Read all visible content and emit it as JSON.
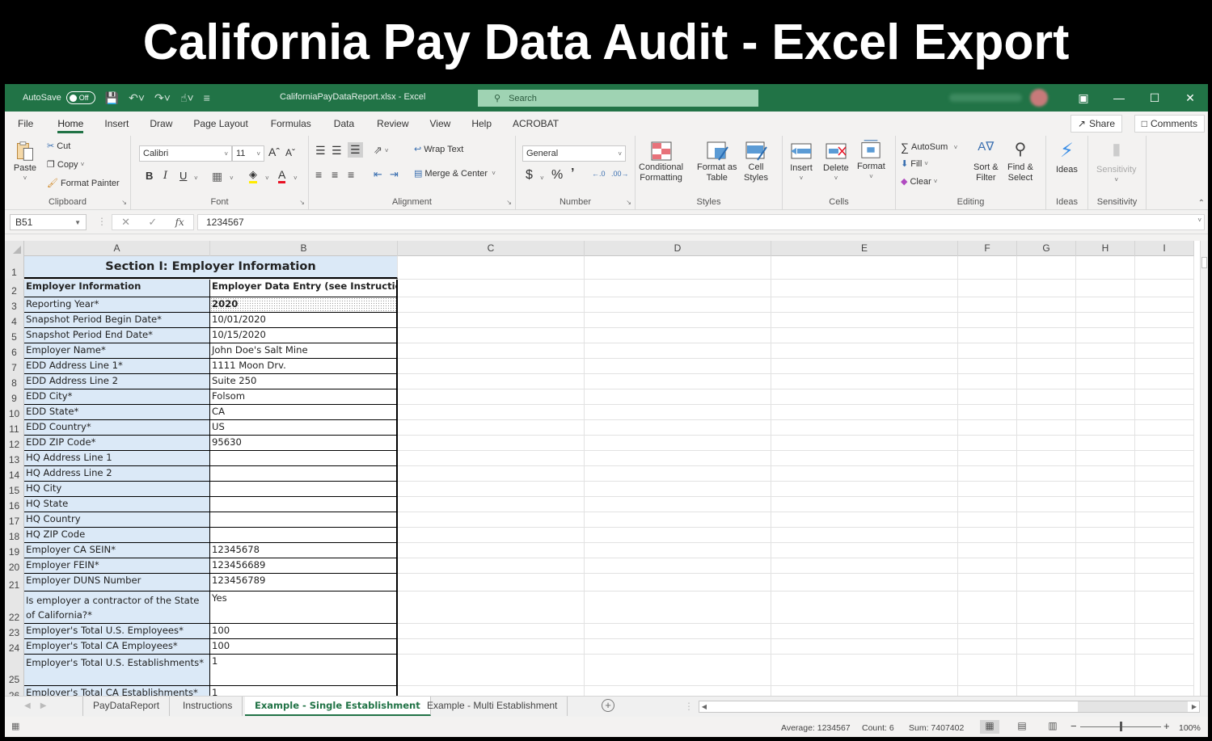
{
  "banner": {
    "title": "California Pay Data Audit - Excel Export"
  },
  "titlebar": {
    "autosave_label": "AutoSave",
    "autosave_state": "Off",
    "filename": "CaliforniaPayDataReport.xlsx  -  Excel",
    "search_placeholder": "Search"
  },
  "menu": {
    "tabs": [
      "File",
      "Home",
      "Insert",
      "Draw",
      "Page Layout",
      "Formulas",
      "Data",
      "Review",
      "View",
      "Help",
      "ACROBAT"
    ],
    "active": "Home",
    "share_label": "Share",
    "comments_label": "Comments"
  },
  "ribbon": {
    "clipboard": {
      "label": "Clipboard",
      "paste": "Paste",
      "cut": "Cut",
      "copy": "Copy",
      "format_painter": "Format Painter"
    },
    "font": {
      "label": "Font",
      "font_name": "Calibri",
      "font_size": "11",
      "bold": "B",
      "italic": "I",
      "underline": "U"
    },
    "alignment": {
      "label": "Alignment",
      "wrap_text": "Wrap Text",
      "merge_center": "Merge & Center"
    },
    "number": {
      "label": "Number",
      "format": "General",
      "currency": "$",
      "percent": "%",
      "comma": "9"
    },
    "styles": {
      "label": "Styles",
      "conditional_formatting": [
        "Conditional",
        "Formatting"
      ],
      "format_as_table": [
        "Format as",
        "Table"
      ],
      "cell_styles": [
        "Cell",
        "Styles"
      ]
    },
    "cells": {
      "label": "Cells",
      "insert": "Insert",
      "delete": "Delete",
      "format": "Format"
    },
    "editing": {
      "label": "Editing",
      "autosum": "AutoSum",
      "fill": "Fill",
      "clear": "Clear",
      "sort_filter": [
        "Sort &",
        "Filter"
      ],
      "find_select": [
        "Find &",
        "Select"
      ]
    },
    "ideas": {
      "label": "Ideas",
      "button": "Ideas"
    },
    "sensitivity": {
      "label": "Sensitivity",
      "button": "Sensitivity"
    }
  },
  "formula_bar": {
    "name_box": "B51",
    "formula": "1234567"
  },
  "columns": [
    "A",
    "B",
    "C",
    "D",
    "E",
    "F",
    "G",
    "H",
    "I"
  ],
  "sheet": {
    "title": "Section I: Employer Information",
    "header": [
      "Employer Information",
      "Employer Data Entry (see Instructions)"
    ],
    "rows": [
      {
        "num": "1"
      },
      {
        "num": "2"
      },
      {
        "num": "3",
        "label": "Reporting Year*",
        "value": "2020"
      },
      {
        "num": "4",
        "label": "Snapshot Period Begin Date*",
        "value": "10/01/2020"
      },
      {
        "num": "5",
        "label": "Snapshot Period End Date*",
        "value": "10/15/2020"
      },
      {
        "num": "6",
        "label": "Employer Name*",
        "value": "John Doe's Salt Mine"
      },
      {
        "num": "7",
        "label": "EDD Address Line 1*",
        "value": "1111 Moon Drv."
      },
      {
        "num": "8",
        "label": "EDD Address Line 2",
        "value": "Suite 250"
      },
      {
        "num": "9",
        "label": "EDD City*",
        "value": "Folsom"
      },
      {
        "num": "10",
        "label": "EDD State*",
        "value": "CA"
      },
      {
        "num": "11",
        "label": "EDD Country*",
        "value": "US"
      },
      {
        "num": "12",
        "label": "EDD ZIP Code*",
        "value": "95630"
      },
      {
        "num": "13",
        "label": "HQ Address Line 1",
        "value": ""
      },
      {
        "num": "14",
        "label": "HQ Address Line 2",
        "value": ""
      },
      {
        "num": "15",
        "label": "HQ City",
        "value": ""
      },
      {
        "num": "16",
        "label": "HQ State",
        "value": ""
      },
      {
        "num": "17",
        "label": "HQ Country",
        "value": ""
      },
      {
        "num": "18",
        "label": "HQ ZIP Code",
        "value": ""
      },
      {
        "num": "19",
        "label": "Employer CA SEIN*",
        "value": "12345678"
      },
      {
        "num": "20",
        "label": "Employer FEIN*",
        "value": "123456689"
      },
      {
        "num": "21",
        "label": "Employer DUNS Number",
        "value": "123456789"
      },
      {
        "num": "22",
        "label": "Is employer a contractor of the State of California?*",
        "value": "Yes"
      },
      {
        "num": "23",
        "label": "Employer's Total U.S. Employees*",
        "value": "100"
      },
      {
        "num": "24",
        "label": "Employer's Total CA Employees*",
        "value": "100"
      },
      {
        "num": "25",
        "label": "Employer's Total U.S. Establishments*",
        "value": "1"
      },
      {
        "num": "26",
        "label": "Employer's Total CA Establishments*",
        "value": "1"
      }
    ]
  },
  "sheet_tabs": {
    "tabs": [
      "PayDataReport",
      "Instructions",
      "Example - Single Establishment",
      "Example - Multi Establishment"
    ],
    "active": "Example - Single Establishment"
  },
  "status": {
    "average": "Average: 1234567",
    "count": "Count: 6",
    "sum": "Sum: 7407402",
    "zoom": "100%"
  }
}
